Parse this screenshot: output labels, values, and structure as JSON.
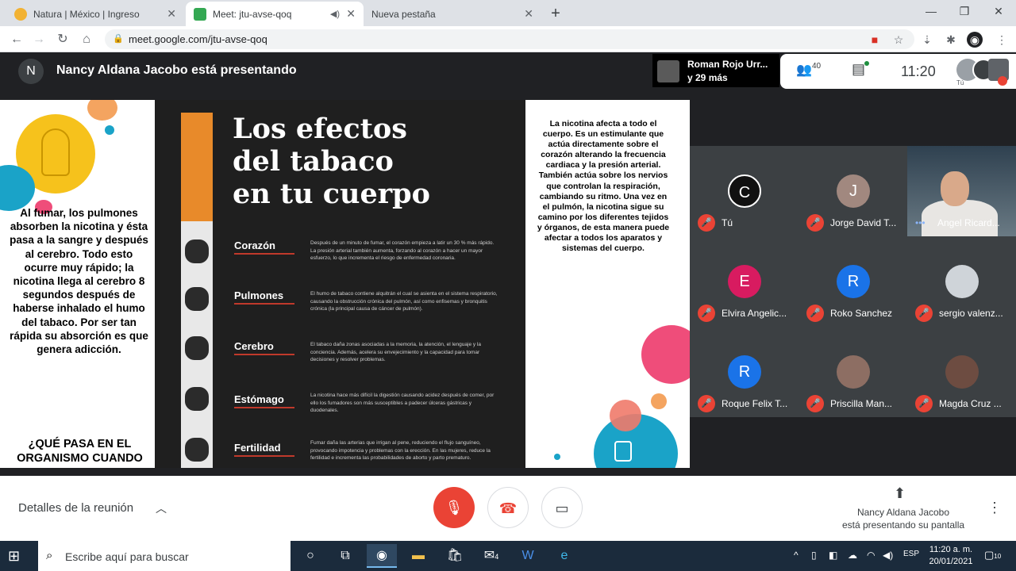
{
  "browser": {
    "tabs": [
      {
        "title": "Natura | México | Ingreso",
        "favicon_color": "#f2b233",
        "active": false
      },
      {
        "title": "Meet: jtu-avse-qoq",
        "favicon_color": "#34a853",
        "active": true
      },
      {
        "title": "Nueva pestaña",
        "active": false
      }
    ],
    "url": "meet.google.com/jtu-avse-qoq",
    "new_tab_label": "+",
    "controls": {
      "minimize": "—",
      "maximize": "❐",
      "close": "✕"
    }
  },
  "meet": {
    "presenter_avatar_letter": "N",
    "presenting_title": "Nancy Aldana Jacobo está presentando",
    "others_name": "Roman Rojo Urr...",
    "others_more": "y 29 más",
    "participant_count": "40",
    "clock": "11:20",
    "self_label": "Tú",
    "bottom": {
      "details_label": "Detalles de la reunión",
      "presenter_line1": "Nancy Aldana Jacobo",
      "presenter_line2": "está presentando su pantalla"
    }
  },
  "slide": {
    "left_text": "Al fumar, los pulmones absorben la nicotina y ésta pasa a la sangre y después al cerebro. Todo esto ocurre muy rápido; la nicotina llega al cerebro 8 segundos después de haberse inhalado el humo del tabaco. Por ser tan rápida su absorción es que genera adicción.",
    "left_question": "¿QUÉ PASA EN EL ORGANISMO CUANDO",
    "title_lines": [
      "Los efectos",
      "del tabaco",
      "en tu cuerpo"
    ],
    "organs": [
      {
        "label": "Corazón",
        "desc": "Después de un minuto de fumar, el corazón empieza a latir un 30 % más rápido. La presión arterial también aumenta, forzando al corazón a hacer un mayor esfuerzo, lo que incrementa el riesgo de enfermedad coronaria."
      },
      {
        "label": "Pulmones",
        "desc": "El humo de tabaco contiene alquitrán el cual se asienta en el sistema respiratorio, causando la obstrucción crónica del pulmón, así como enfisemas y bronquitis crónica (la principal causa de cáncer de pulmón)."
      },
      {
        "label": "Cerebro",
        "desc": "El tabaco daña zonas asociadas a la memoria, la atención, el lenguaje y la conciencia. Además, acelera su envejecimiento y la capacidad para tomar decisiones y resolver problemas."
      },
      {
        "label": "Estómago",
        "desc": "La nicotina hace más difícil la digestión causando acidez después de comer, por ello los fumadores son más susceptibles a padecer úlceras gástricas y duodenales."
      },
      {
        "label": "Fertilidad",
        "desc": "Fumar daña las arterias que irrigan al pene, reduciendo el flujo sanguíneo, provocando impotencia y problemas con la erección. En las mujeres, reduce la fertilidad e incrementa las probabilidades de aborto y parto prematuro."
      }
    ],
    "right_text": "La nicotina afecta a todo el cuerpo. Es un estimulante que actúa directamente sobre el corazón alterando la frecuencia cardiaca y la presión arterial. También actúa sobre los nervios que controlan la respiración, cambiando su ritmo. Una vez en el pulmón, la nicotina sigue su camino por los diferentes tejidos y órganos, de esta manera puede afectar a todos los aparatos y sistemas del cuerpo."
  },
  "participants": [
    {
      "name": "Tú",
      "initial": "C",
      "color": "#111111"
    },
    {
      "name": "Jorge David T...",
      "initial": "J",
      "color": "#a1887f"
    },
    {
      "name": "Angel Ricard...",
      "video": true
    },
    {
      "name": "Elvira Angelic...",
      "initial": "E",
      "color": "#d81b60"
    },
    {
      "name": "Roko Sanchez",
      "initial": "R",
      "color": "#1a73e8"
    },
    {
      "name": "sergio valenz...",
      "photo": true,
      "color": "#cfd4d9"
    },
    {
      "name": "Roque Felix T...",
      "initial": "R",
      "color": "#1a73e8"
    },
    {
      "name": "Priscilla Man...",
      "photo": true,
      "color": "#8d6e63"
    },
    {
      "name": "Magda Cruz ...",
      "photo": true,
      "color": "#6d4c41"
    }
  ],
  "taskbar": {
    "search_placeholder": "Escribe aquí para buscar",
    "language": "ESP",
    "time": "11:20 a. m.",
    "date": "20/01/2021",
    "mail_badge": "4",
    "notification_count": "10"
  }
}
